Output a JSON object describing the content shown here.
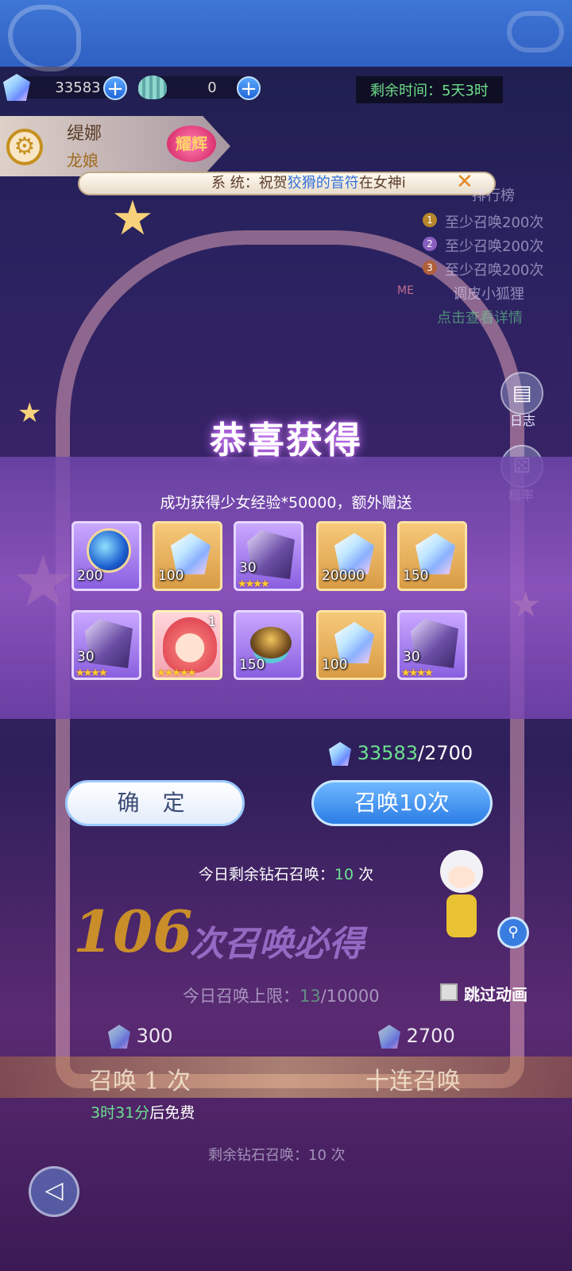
{
  "header": {
    "currency": [
      {
        "icon": "gem-icon",
        "value": "33583"
      },
      {
        "icon": "shell-icon",
        "value": "0"
      }
    ],
    "timer": "剩余时间：5天3时"
  },
  "character": {
    "name": "缇娜",
    "title": "龙娘",
    "badge": "耀辉"
  },
  "announcement": {
    "prefix": "系  统：祝贺",
    "player": "狡猾的音符",
    "suffix": "在女神i"
  },
  "ranking": {
    "title": "排行榜",
    "entries": [
      "至少召唤200次",
      "至少召唤200次",
      "至少召唤200次"
    ],
    "me_label": "ME",
    "me_entry": "调皮小狐狸",
    "details": "点击查看详情"
  },
  "side": {
    "log": "日志",
    "prob": "概率"
  },
  "modal": {
    "title": "恭喜获得",
    "subtitle": "成功获得少女经验*50000，额外赠送",
    "items": [
      {
        "icon": "orb-icon",
        "qty": "200",
        "stars": ""
      },
      {
        "icon": "crystal-icon",
        "qty": "100",
        "stars": ""
      },
      {
        "icon": "dark-crystal-icon",
        "qty": "30",
        "stars": "★★★★"
      },
      {
        "icon": "crystal-icon",
        "qty": "20000",
        "stars": ""
      },
      {
        "icon": "crystal-icon",
        "qty": "150",
        "stars": ""
      },
      {
        "icon": "dark-crystal-icon",
        "qty": "30",
        "stars": "★★★★"
      },
      {
        "icon": "girl-portrait-icon",
        "qty": "1",
        "stars": "★★★★★"
      },
      {
        "icon": "golden-egg-icon",
        "qty": "150",
        "stars": ""
      },
      {
        "icon": "crystal-icon",
        "qty": "100",
        "stars": ""
      },
      {
        "icon": "dark-crystal-icon",
        "qty": "30",
        "stars": "★★★★"
      }
    ],
    "balance_have": "33583",
    "balance_need": "/2700",
    "confirm": "确 定",
    "summon10": "召唤10次",
    "today_prefix": "今日剩余钻石召唤：",
    "today_count": "10",
    "today_suffix": " 次"
  },
  "summon": {
    "guarantee_num": "106",
    "guarantee_text": "次召唤必得",
    "limit_prefix": "今日召唤上限：",
    "limit_used": "13",
    "limit_total": "/10000",
    "skip": "跳过动画",
    "cost_one": "300",
    "cost_ten": "2700",
    "pull_one": "召唤 1 次",
    "pull_ten": "十连召唤",
    "free_time": "3时31分",
    "free_suffix": "后免费",
    "remain": "剩余钻石召唤：10 次"
  }
}
